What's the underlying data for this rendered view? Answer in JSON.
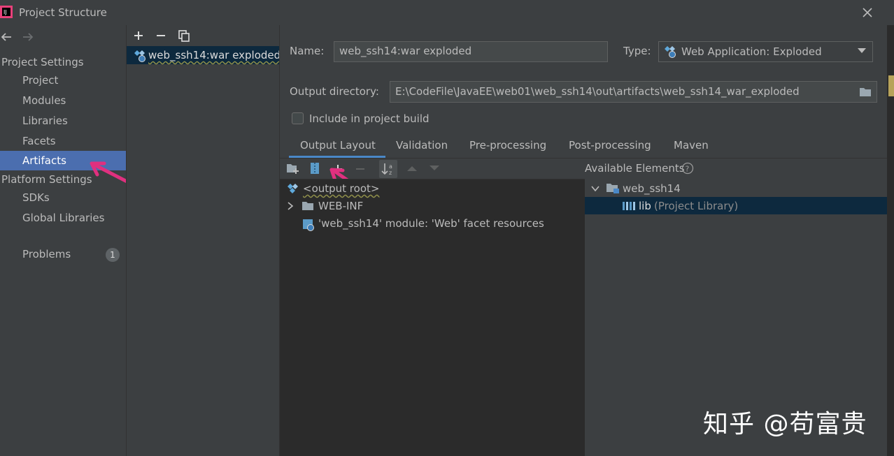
{
  "window": {
    "title": "Project Structure"
  },
  "left_nav": {
    "section1": "Project Settings",
    "items1": [
      "Project",
      "Modules",
      "Libraries",
      "Facets",
      "Artifacts"
    ],
    "section2": "Platform Settings",
    "items2": [
      "SDKs",
      "Global Libraries"
    ],
    "problems": "Problems",
    "problems_count": "1",
    "selected": "Artifacts"
  },
  "artifacts": {
    "items": [
      "web_ssh14:war exploded"
    ]
  },
  "form": {
    "name_label": "Name:",
    "name_value": "web_ssh14:war exploded",
    "type_label": "Type:",
    "type_value": "Web Application: Exploded",
    "output_label": "Output directory:",
    "output_value": "E:\\CodeFile\\JavaEE\\web01\\web_ssh14\\out\\artifacts\\web_ssh14_war_exploded",
    "include_label": "Include in project build",
    "include_checked": false
  },
  "tabs": [
    "Output Layout",
    "Validation",
    "Pre-processing",
    "Post-processing",
    "Maven"
  ],
  "active_tab": "Output Layout",
  "output_tree": [
    "<output root>",
    "WEB-INF",
    "'web_ssh14' module: 'Web' facet resources"
  ],
  "available": {
    "header": "Available Elements",
    "module": "web_ssh14",
    "lib_name": "lib",
    "lib_suffix": "(Project Library)"
  },
  "watermark": "知乎 @苟富贵",
  "colors": {
    "accent": "#4b6eaf",
    "annotation_arrow": "#e0307f",
    "background": "#3c3f41",
    "tree_bg": "#2b2b2b"
  }
}
